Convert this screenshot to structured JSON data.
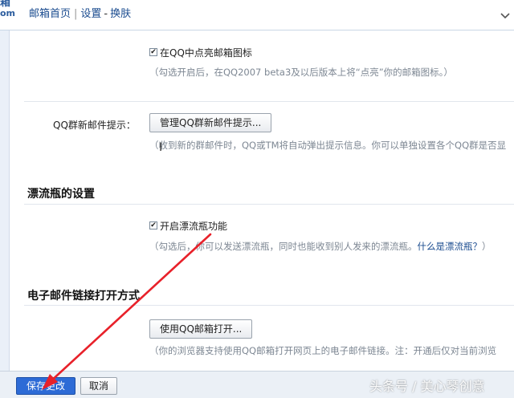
{
  "header": {
    "logo_line1": "箱",
    "logo_line2": "om",
    "nav": {
      "home": "邮箱首页",
      "settings": "设置",
      "skin": "换肤"
    }
  },
  "qq_icon": {
    "checkbox_label": "在QQ中点亮邮箱图标",
    "hint": "（勾选开启后，在QQ2007 beta3及以后版本上将“点亮”你的邮箱图标。）"
  },
  "group_mail": {
    "label": "QQ群新邮件提示：",
    "button": "管理QQ群新邮件提示...",
    "hint": "（收到新的群邮件时，QQ或TM将自动弹出提示信息。你可以单独设置各个QQ群是否显"
  },
  "drift_bottle": {
    "title": "漂流瓶的设置",
    "checkbox_label": "开启漂流瓶功能",
    "hint_text": "（勾选后，你可以发送漂流瓶，同时也能收到别人发来的漂流瓶。",
    "hint_link": "什么是漂流瓶？",
    "hint_end": "）"
  },
  "email_link": {
    "title": "电子邮件链接打开方式",
    "button": "使用QQ邮箱打开...",
    "hint": "（你的浏览器支持使用QQ邮箱打开网页上的电子邮件链接。注：开通后仅对当前浏览"
  },
  "footer": {
    "save": "保存更改",
    "cancel": "取消"
  },
  "watermark": "头条号 / 美心琴创意",
  "colors": {
    "accent": "#2d6bd6",
    "annotation_arrow": "#e8212a"
  }
}
